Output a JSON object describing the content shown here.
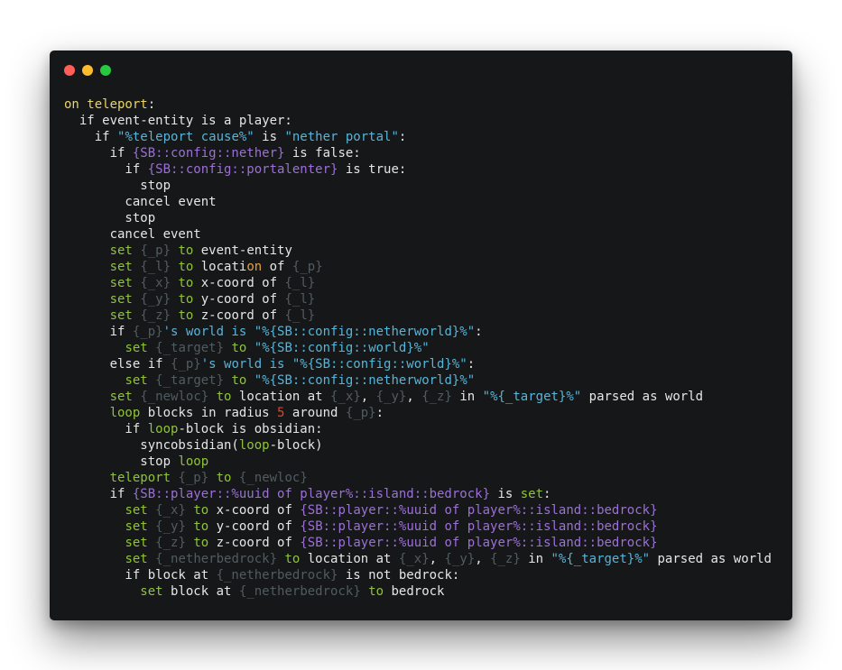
{
  "window": {
    "controls": [
      {
        "name": "close",
        "color": "#ff5f56"
      },
      {
        "name": "minimize",
        "color": "#ffbd2e"
      },
      {
        "name": "zoom",
        "color": "#27c93f"
      }
    ],
    "background": "#151718"
  },
  "colors": {
    "plain": "#e6e6e6",
    "keyword": "#8fc43a",
    "event": "#e9d46a",
    "local_variable": "#515c61",
    "global_variable": "#9c70d6",
    "string": "#55b5db",
    "number": "#e0442c",
    "highlight": "#e6a13a"
  },
  "code": {
    "lines": [
      [
        {
          "t": "event",
          "s": "on teleport"
        },
        {
          "t": "plain",
          "s": ":"
        }
      ],
      [
        {
          "t": "plain",
          "s": "  if event-entity is a player:"
        }
      ],
      [
        {
          "t": "plain",
          "s": "    if "
        },
        {
          "t": "str",
          "s": "\"%teleport cause%\""
        },
        {
          "t": "plain",
          "s": " is "
        },
        {
          "t": "str",
          "s": "\"nether portal\""
        },
        {
          "t": "plain",
          "s": ":"
        }
      ],
      [
        {
          "t": "plain",
          "s": "      if "
        },
        {
          "t": "gvar",
          "s": "{SB::config::nether}"
        },
        {
          "t": "plain",
          "s": " is false:"
        }
      ],
      [
        {
          "t": "plain",
          "s": "        if "
        },
        {
          "t": "gvar",
          "s": "{SB::config::portalenter}"
        },
        {
          "t": "plain",
          "s": " is true:"
        }
      ],
      [
        {
          "t": "plain",
          "s": "          stop"
        }
      ],
      [
        {
          "t": "plain",
          "s": "        cancel event"
        }
      ],
      [
        {
          "t": "plain",
          "s": "        stop"
        }
      ],
      [
        {
          "t": "plain",
          "s": "      cancel event"
        }
      ],
      [
        {
          "t": "plain",
          "s": "      "
        },
        {
          "t": "kw",
          "s": "set"
        },
        {
          "t": "plain",
          "s": " "
        },
        {
          "t": "var",
          "s": "{_p}"
        },
        {
          "t": "plain",
          "s": " "
        },
        {
          "t": "kw",
          "s": "to"
        },
        {
          "t": "plain",
          "s": " event-entity"
        }
      ],
      [
        {
          "t": "plain",
          "s": "      "
        },
        {
          "t": "kw",
          "s": "set"
        },
        {
          "t": "plain",
          "s": " "
        },
        {
          "t": "var",
          "s": "{_l}"
        },
        {
          "t": "plain",
          "s": " "
        },
        {
          "t": "kw",
          "s": "to"
        },
        {
          "t": "plain",
          "s": " locati"
        },
        {
          "t": "orange",
          "s": "on"
        },
        {
          "t": "plain",
          "s": " of "
        },
        {
          "t": "var",
          "s": "{_p}"
        }
      ],
      [
        {
          "t": "plain",
          "s": "      "
        },
        {
          "t": "kw",
          "s": "set"
        },
        {
          "t": "plain",
          "s": " "
        },
        {
          "t": "var",
          "s": "{_x}"
        },
        {
          "t": "plain",
          "s": " "
        },
        {
          "t": "kw",
          "s": "to"
        },
        {
          "t": "plain",
          "s": " x-coord of "
        },
        {
          "t": "var",
          "s": "{_l}"
        }
      ],
      [
        {
          "t": "plain",
          "s": "      "
        },
        {
          "t": "kw",
          "s": "set"
        },
        {
          "t": "plain",
          "s": " "
        },
        {
          "t": "var",
          "s": "{_y}"
        },
        {
          "t": "plain",
          "s": " "
        },
        {
          "t": "kw",
          "s": "to"
        },
        {
          "t": "plain",
          "s": " y-coord of "
        },
        {
          "t": "var",
          "s": "{_l}"
        }
      ],
      [
        {
          "t": "plain",
          "s": "      "
        },
        {
          "t": "kw",
          "s": "set"
        },
        {
          "t": "plain",
          "s": " "
        },
        {
          "t": "var",
          "s": "{_z}"
        },
        {
          "t": "plain",
          "s": " "
        },
        {
          "t": "kw",
          "s": "to"
        },
        {
          "t": "plain",
          "s": " z-coord of "
        },
        {
          "t": "var",
          "s": "{_l}"
        }
      ],
      [
        {
          "t": "plain",
          "s": "      if "
        },
        {
          "t": "var",
          "s": "{_p}"
        },
        {
          "t": "str",
          "s": "'s world is \"%{SB::config::netherworld}%\""
        },
        {
          "t": "plain",
          "s": ":"
        }
      ],
      [
        {
          "t": "plain",
          "s": "        "
        },
        {
          "t": "kw",
          "s": "set"
        },
        {
          "t": "plain",
          "s": " "
        },
        {
          "t": "var",
          "s": "{_target}"
        },
        {
          "t": "plain",
          "s": " "
        },
        {
          "t": "kw",
          "s": "to"
        },
        {
          "t": "plain",
          "s": " "
        },
        {
          "t": "str",
          "s": "\"%{SB::config::world}%\""
        }
      ],
      [
        {
          "t": "plain",
          "s": "      else if "
        },
        {
          "t": "var",
          "s": "{_p}"
        },
        {
          "t": "str",
          "s": "'s world is \"%{SB::config::world}%\""
        },
        {
          "t": "plain",
          "s": ":"
        }
      ],
      [
        {
          "t": "plain",
          "s": "        "
        },
        {
          "t": "kw",
          "s": "set"
        },
        {
          "t": "plain",
          "s": " "
        },
        {
          "t": "var",
          "s": "{_target}"
        },
        {
          "t": "plain",
          "s": " "
        },
        {
          "t": "kw",
          "s": "to"
        },
        {
          "t": "plain",
          "s": " "
        },
        {
          "t": "str",
          "s": "\"%{SB::config::netherworld}%\""
        }
      ],
      [
        {
          "t": "plain",
          "s": "      "
        },
        {
          "t": "kw",
          "s": "set"
        },
        {
          "t": "plain",
          "s": " "
        },
        {
          "t": "var",
          "s": "{_newloc}"
        },
        {
          "t": "plain",
          "s": " "
        },
        {
          "t": "kw",
          "s": "to"
        },
        {
          "t": "plain",
          "s": " location at "
        },
        {
          "t": "var",
          "s": "{_x}"
        },
        {
          "t": "plain",
          "s": ", "
        },
        {
          "t": "var",
          "s": "{_y}"
        },
        {
          "t": "plain",
          "s": ", "
        },
        {
          "t": "var",
          "s": "{_z}"
        },
        {
          "t": "plain",
          "s": " in "
        },
        {
          "t": "str",
          "s": "\"%{_target}%\""
        },
        {
          "t": "plain",
          "s": " parsed as world"
        }
      ],
      [
        {
          "t": "plain",
          "s": "      "
        },
        {
          "t": "kw",
          "s": "loop"
        },
        {
          "t": "plain",
          "s": " blocks in radius "
        },
        {
          "t": "num",
          "s": "5"
        },
        {
          "t": "plain",
          "s": " around "
        },
        {
          "t": "var",
          "s": "{_p}"
        },
        {
          "t": "plain",
          "s": ":"
        }
      ],
      [
        {
          "t": "plain",
          "s": "        if "
        },
        {
          "t": "kw",
          "s": "loop"
        },
        {
          "t": "plain",
          "s": "-block is obsidian:"
        }
      ],
      [
        {
          "t": "plain",
          "s": "          syncobsidian("
        },
        {
          "t": "kw",
          "s": "loop"
        },
        {
          "t": "plain",
          "s": "-block)"
        }
      ],
      [
        {
          "t": "plain",
          "s": "          stop "
        },
        {
          "t": "kw",
          "s": "loop"
        }
      ],
      [
        {
          "t": "plain",
          "s": "      "
        },
        {
          "t": "kw",
          "s": "teleport"
        },
        {
          "t": "plain",
          "s": " "
        },
        {
          "t": "var",
          "s": "{_p}"
        },
        {
          "t": "plain",
          "s": " "
        },
        {
          "t": "kw",
          "s": "to"
        },
        {
          "t": "plain",
          "s": " "
        },
        {
          "t": "var",
          "s": "{_newloc}"
        }
      ],
      [
        {
          "t": "plain",
          "s": "      if "
        },
        {
          "t": "gvar",
          "s": "{SB::player::%uuid of player%::island::bedrock}"
        },
        {
          "t": "plain",
          "s": " is "
        },
        {
          "t": "kw",
          "s": "set"
        },
        {
          "t": "plain",
          "s": ":"
        }
      ],
      [
        {
          "t": "plain",
          "s": "        "
        },
        {
          "t": "kw",
          "s": "set"
        },
        {
          "t": "plain",
          "s": " "
        },
        {
          "t": "var",
          "s": "{_x}"
        },
        {
          "t": "plain",
          "s": " "
        },
        {
          "t": "kw",
          "s": "to"
        },
        {
          "t": "plain",
          "s": " x-coord of "
        },
        {
          "t": "gvar",
          "s": "{SB::player::%uuid of player%::island::bedrock}"
        }
      ],
      [
        {
          "t": "plain",
          "s": "        "
        },
        {
          "t": "kw",
          "s": "set"
        },
        {
          "t": "plain",
          "s": " "
        },
        {
          "t": "var",
          "s": "{_y}"
        },
        {
          "t": "plain",
          "s": " "
        },
        {
          "t": "kw",
          "s": "to"
        },
        {
          "t": "plain",
          "s": " y-coord of "
        },
        {
          "t": "gvar",
          "s": "{SB::player::%uuid of player%::island::bedrock}"
        }
      ],
      [
        {
          "t": "plain",
          "s": "        "
        },
        {
          "t": "kw",
          "s": "set"
        },
        {
          "t": "plain",
          "s": " "
        },
        {
          "t": "var",
          "s": "{_z}"
        },
        {
          "t": "plain",
          "s": " "
        },
        {
          "t": "kw",
          "s": "to"
        },
        {
          "t": "plain",
          "s": " z-coord of "
        },
        {
          "t": "gvar",
          "s": "{SB::player::%uuid of player%::island::bedrock}"
        }
      ],
      [
        {
          "t": "plain",
          "s": "        "
        },
        {
          "t": "kw",
          "s": "set"
        },
        {
          "t": "plain",
          "s": " "
        },
        {
          "t": "var",
          "s": "{_netherbedrock}"
        },
        {
          "t": "plain",
          "s": " "
        },
        {
          "t": "kw",
          "s": "to"
        },
        {
          "t": "plain",
          "s": " location at "
        },
        {
          "t": "var",
          "s": "{_x}"
        },
        {
          "t": "plain",
          "s": ", "
        },
        {
          "t": "var",
          "s": "{_y}"
        },
        {
          "t": "plain",
          "s": ", "
        },
        {
          "t": "var",
          "s": "{_z}"
        },
        {
          "t": "plain",
          "s": " in "
        },
        {
          "t": "str",
          "s": "\"%{_target}%\""
        },
        {
          "t": "plain",
          "s": " parsed as world"
        }
      ],
      [
        {
          "t": "plain",
          "s": "        if block at "
        },
        {
          "t": "var",
          "s": "{_netherbedrock}"
        },
        {
          "t": "plain",
          "s": " is not bedrock:"
        }
      ],
      [
        {
          "t": "plain",
          "s": "          "
        },
        {
          "t": "kw",
          "s": "set"
        },
        {
          "t": "plain",
          "s": " block at "
        },
        {
          "t": "var",
          "s": "{_netherbedrock}"
        },
        {
          "t": "plain",
          "s": " "
        },
        {
          "t": "kw",
          "s": "to"
        },
        {
          "t": "plain",
          "s": " bedrock"
        }
      ]
    ]
  }
}
